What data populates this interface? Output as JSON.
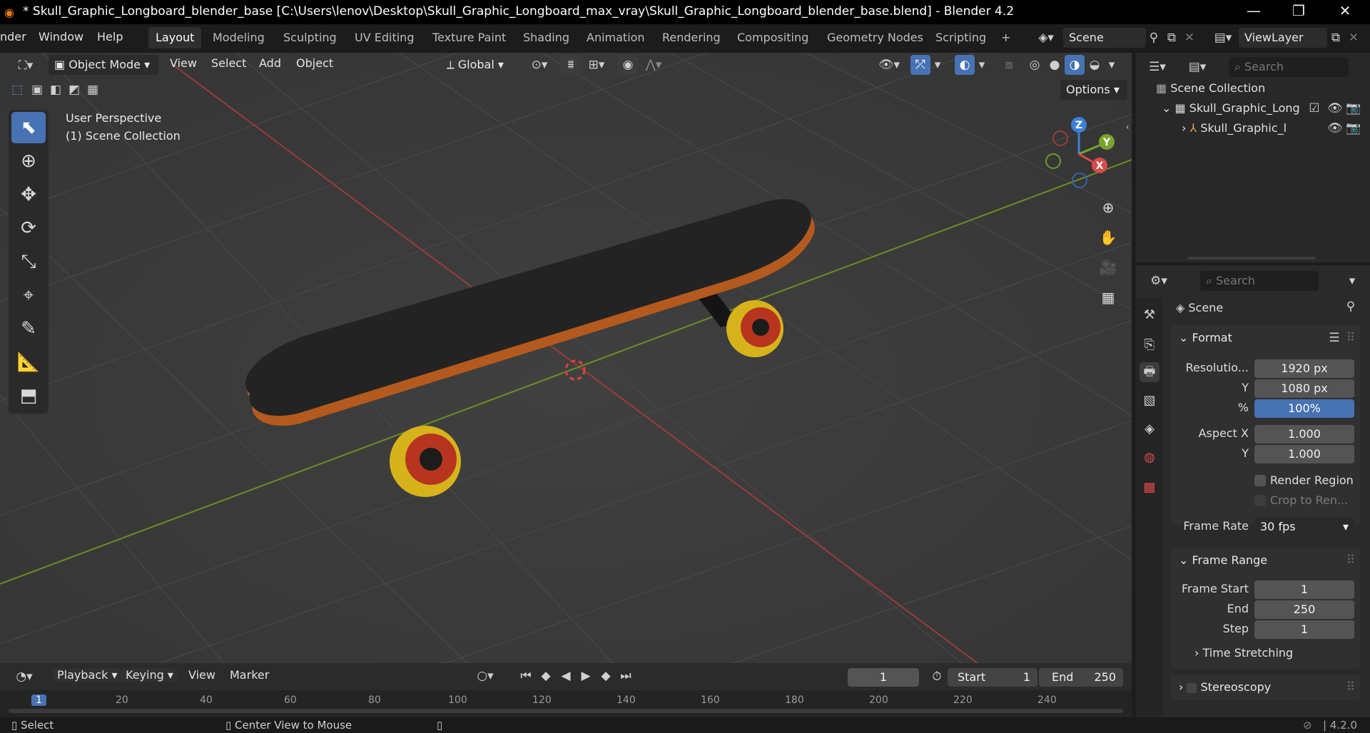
{
  "window": {
    "title": "* Skull_Graphic_Longboard_blender_base [C:\\Users\\lenov\\Desktop\\Skull_Graphic_Longboard_max_vray\\Skull_Graphic_Longboard_blender_base.blend] - Blender 4.2",
    "minimize": "—",
    "maximize": "❐",
    "close": "✕"
  },
  "menu": {
    "items": [
      "nder",
      "Window",
      "Help"
    ]
  },
  "workspaces": [
    "Layout",
    "Modeling",
    "Sculpting",
    "UV Editing",
    "Texture Paint",
    "Shading",
    "Animation",
    "Rendering",
    "Compositing",
    "Geometry Nodes",
    "Scripting",
    "+"
  ],
  "scene": {
    "name": "Scene",
    "view_layer": "ViewLayer"
  },
  "viewport": {
    "mode": "Object Mode",
    "menus": [
      "View",
      "Select",
      "Add",
      "Object"
    ],
    "transform_orientation": "Global",
    "options_label": "Options",
    "perspective_text": "User Perspective",
    "collection_text": "(1) Scene Collection",
    "gizmo": {
      "x": "X",
      "y": "Y",
      "z": "Z"
    },
    "accent_color": "#4772b3"
  },
  "outliner": {
    "search_placeholder": "Search",
    "root": "Scene Collection",
    "collection": "Skull_Graphic_Long",
    "object": "Skull_Graphic_l"
  },
  "properties": {
    "search_placeholder": "Search",
    "context": "Scene",
    "format": {
      "header": "Format",
      "resolution_label": "Resolutio...",
      "res_x": "1920 px",
      "y_label": "Y",
      "res_y": "1080 px",
      "pct_label": "%",
      "pct": "100%",
      "aspect_x_label": "Aspect X",
      "aspect_x": "1.000",
      "aspect_y_label": "Y",
      "aspect_y": "1.000",
      "render_region": "Render Region",
      "crop": "Crop to Ren...",
      "frame_rate_label": "Frame Rate",
      "frame_rate": "30 fps"
    },
    "frame_range": {
      "header": "Frame Range",
      "start_label": "Frame Start",
      "start": "1",
      "end_label": "End",
      "end": "250",
      "step_label": "Step",
      "step": "1",
      "time_stretching": "Time Stretching"
    },
    "stereoscopy": "Stereoscopy"
  },
  "timeline": {
    "menus": [
      "Playback",
      "Keying",
      "View",
      "Marker"
    ],
    "current_frame": "1",
    "start_label": "Start",
    "start": "1",
    "end_label": "End",
    "end": "250",
    "ruler": [
      "1",
      "20",
      "40",
      "60",
      "80",
      "100",
      "120",
      "140",
      "160",
      "180",
      "200",
      "220",
      "240"
    ]
  },
  "status": {
    "select": "Select",
    "center": "Center View to Mouse",
    "version": "4.2.0"
  }
}
